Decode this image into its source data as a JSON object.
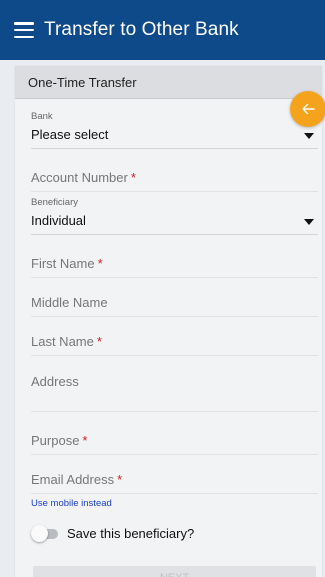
{
  "appbar": {
    "title": "Transfer to Other Bank",
    "menu_icon": "hamburger-menu-icon",
    "color": "#0e4a8a"
  },
  "panel": {
    "title": "One-Time Transfer",
    "back_icon": "arrow-left-icon",
    "back_color": "#f5a31d"
  },
  "form": {
    "bank": {
      "label": "Bank",
      "value": "Please select"
    },
    "account_number": {
      "placeholder": "Account Number",
      "required": "*"
    },
    "beneficiary": {
      "label": "Beneficiary",
      "value": "Individual"
    },
    "first_name": {
      "placeholder": "First Name",
      "required": "*"
    },
    "middle_name": {
      "placeholder": "Middle Name"
    },
    "last_name": {
      "placeholder": "Last Name",
      "required": "*"
    },
    "address": {
      "placeholder": "Address"
    },
    "purpose": {
      "placeholder": "Purpose",
      "required": "*"
    },
    "email": {
      "placeholder": "Email Address",
      "required": "*"
    },
    "use_mobile_link": "Use mobile instead",
    "save_beneficiary": {
      "label": "Save this beneficiary?",
      "checked": false
    },
    "next_button": "NEXT"
  }
}
